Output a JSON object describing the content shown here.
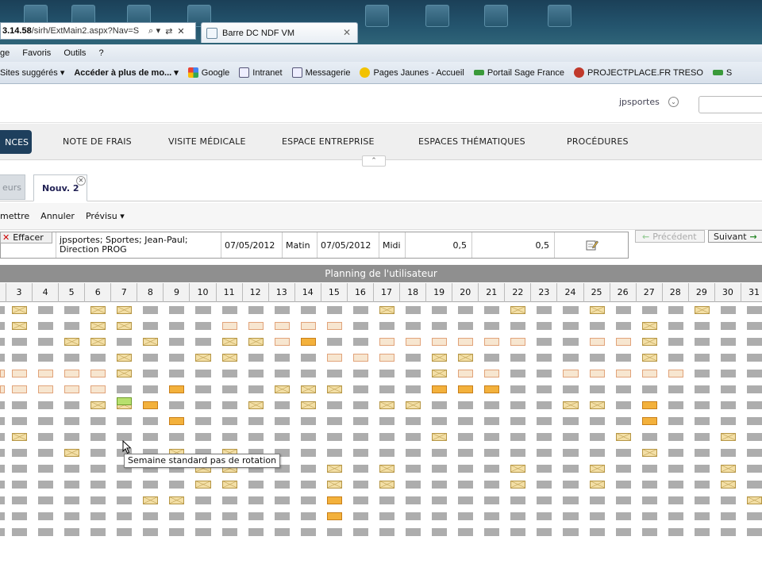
{
  "browser": {
    "address_bold": "3.14.58",
    "address_rest": "/sirh/ExtMain2.aspx?Nav=S",
    "tab_title": "Barre DC NDF VM"
  },
  "menubar": [
    "ge",
    "Favoris",
    "Outils",
    "?"
  ],
  "favorites": [
    {
      "label": "Sites suggérés ▾",
      "bold": false
    },
    {
      "label": "Accéder à plus de mo... ▾",
      "bold": true
    },
    {
      "label": "Google",
      "bold": false
    },
    {
      "label": "Intranet",
      "bold": false
    },
    {
      "label": "Messagerie",
      "bold": false
    },
    {
      "label": "Pages Jaunes - Accueil",
      "bold": false
    },
    {
      "label": "Portail Sage France",
      "bold": false
    },
    {
      "label": "PROJECTPLACE.FR TRESO",
      "bold": false
    },
    {
      "label": "S",
      "bold": false
    }
  ],
  "header": {
    "user": "jpsportes"
  },
  "nav": {
    "active": "NCES",
    "items": [
      "NOTE DE FRAIS",
      "VISITE MÉDICALE",
      "ESPACE ENTREPRISE",
      "ESPACES THÉMATIQUES",
      "PROCÉDURES"
    ]
  },
  "subtabs": {
    "inactive": "eurs",
    "active": "Nouv. 2"
  },
  "toolbar": [
    "mettre",
    "Annuler",
    "Prévisu ▾"
  ],
  "record": {
    "effacer": "Effacer",
    "person": "jpsportes; Sportes; Jean-Paul;",
    "direction": "Direction PROG",
    "date_start": "07/05/2012",
    "period_start": "Matin",
    "date_end": "07/05/2012",
    "period_end": "Midi",
    "value1": "0,5",
    "value2": "0,5",
    "prev_label": "Précédent",
    "next_label": "Suivant"
  },
  "planning": {
    "title": "Planning de l'utilisateur",
    "days": [
      "3",
      "4",
      "5",
      "6",
      "7",
      "8",
      "9",
      "10",
      "11",
      "12",
      "13",
      "14",
      "15",
      "16",
      "17",
      "18",
      "19",
      "20",
      "21",
      "22",
      "23",
      "24",
      "25",
      "26",
      "27",
      "28",
      "29",
      "30",
      "31"
    ],
    "rows": [
      "eggeegggggggggeggggeggegggeg",
      "eggeegggpppppgggggggggggeggg",
      "ggeegeggeepoggppppppggppeggg",
      "ggggeggeegggpppgeeggggggeggg",
      "ppppegggggggggggeppggpppppgg",
      "ppppggfgggeeegggoffggggggggg",
      "gggeefgggegeggeegggggeegfggg",
      "ggggggfgggggggggggggggggfgggg",
      "egggggggggggggggeggggggeggge",
      "ggegggegegggggggggggggggegggg",
      "gggggggeegggegeggggeggegggge",
      "gggggggeegggegeggggeggegggge",
      "gggggeegggggoggggggggggggggge",
      "ggggggggggggoggggggggggggggg",
      "gggggggggggggggggggggggggggg"
    ],
    "tooltip": "Semaine standard pas de rotation"
  }
}
